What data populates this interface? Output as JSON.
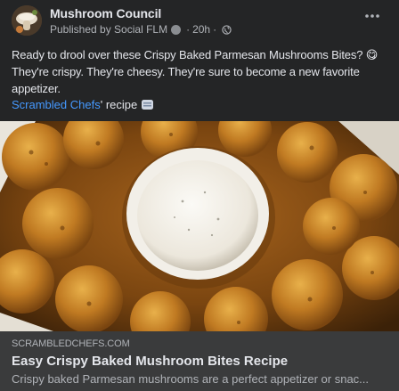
{
  "post": {
    "page_name": "Mushroom Council",
    "published_by": "Published by Social FLM",
    "separator": "·",
    "time": "20h",
    "more_label": "···",
    "text": "Ready to drool over these Crispy Baked Parmesan Mushrooms Bites? 😋 They're crispy. They're cheesy. They're sure to become a new favorite appetizer.",
    "credit_link": "Scrambled Chefs",
    "credit_suffix": "' recipe"
  },
  "link_card": {
    "domain": "SCRAMBLEDCHEFS.COM",
    "title": "Easy Crispy Baked Mushroom Bites Recipe",
    "description": "Crispy baked Parmesan mushrooms are a perfect appetizer or snac..."
  },
  "icons": {
    "avatar": "mushroom-council-avatar",
    "published_badge": "info-badge-icon",
    "audience": "globe-icon",
    "more": "more-options-icon",
    "recipe_badge": "recipe-book-icon"
  },
  "colors": {
    "background": "#242526",
    "link": "#4599ff",
    "card": "#3a3b3c",
    "secondary_text": "#b0b3b8"
  }
}
